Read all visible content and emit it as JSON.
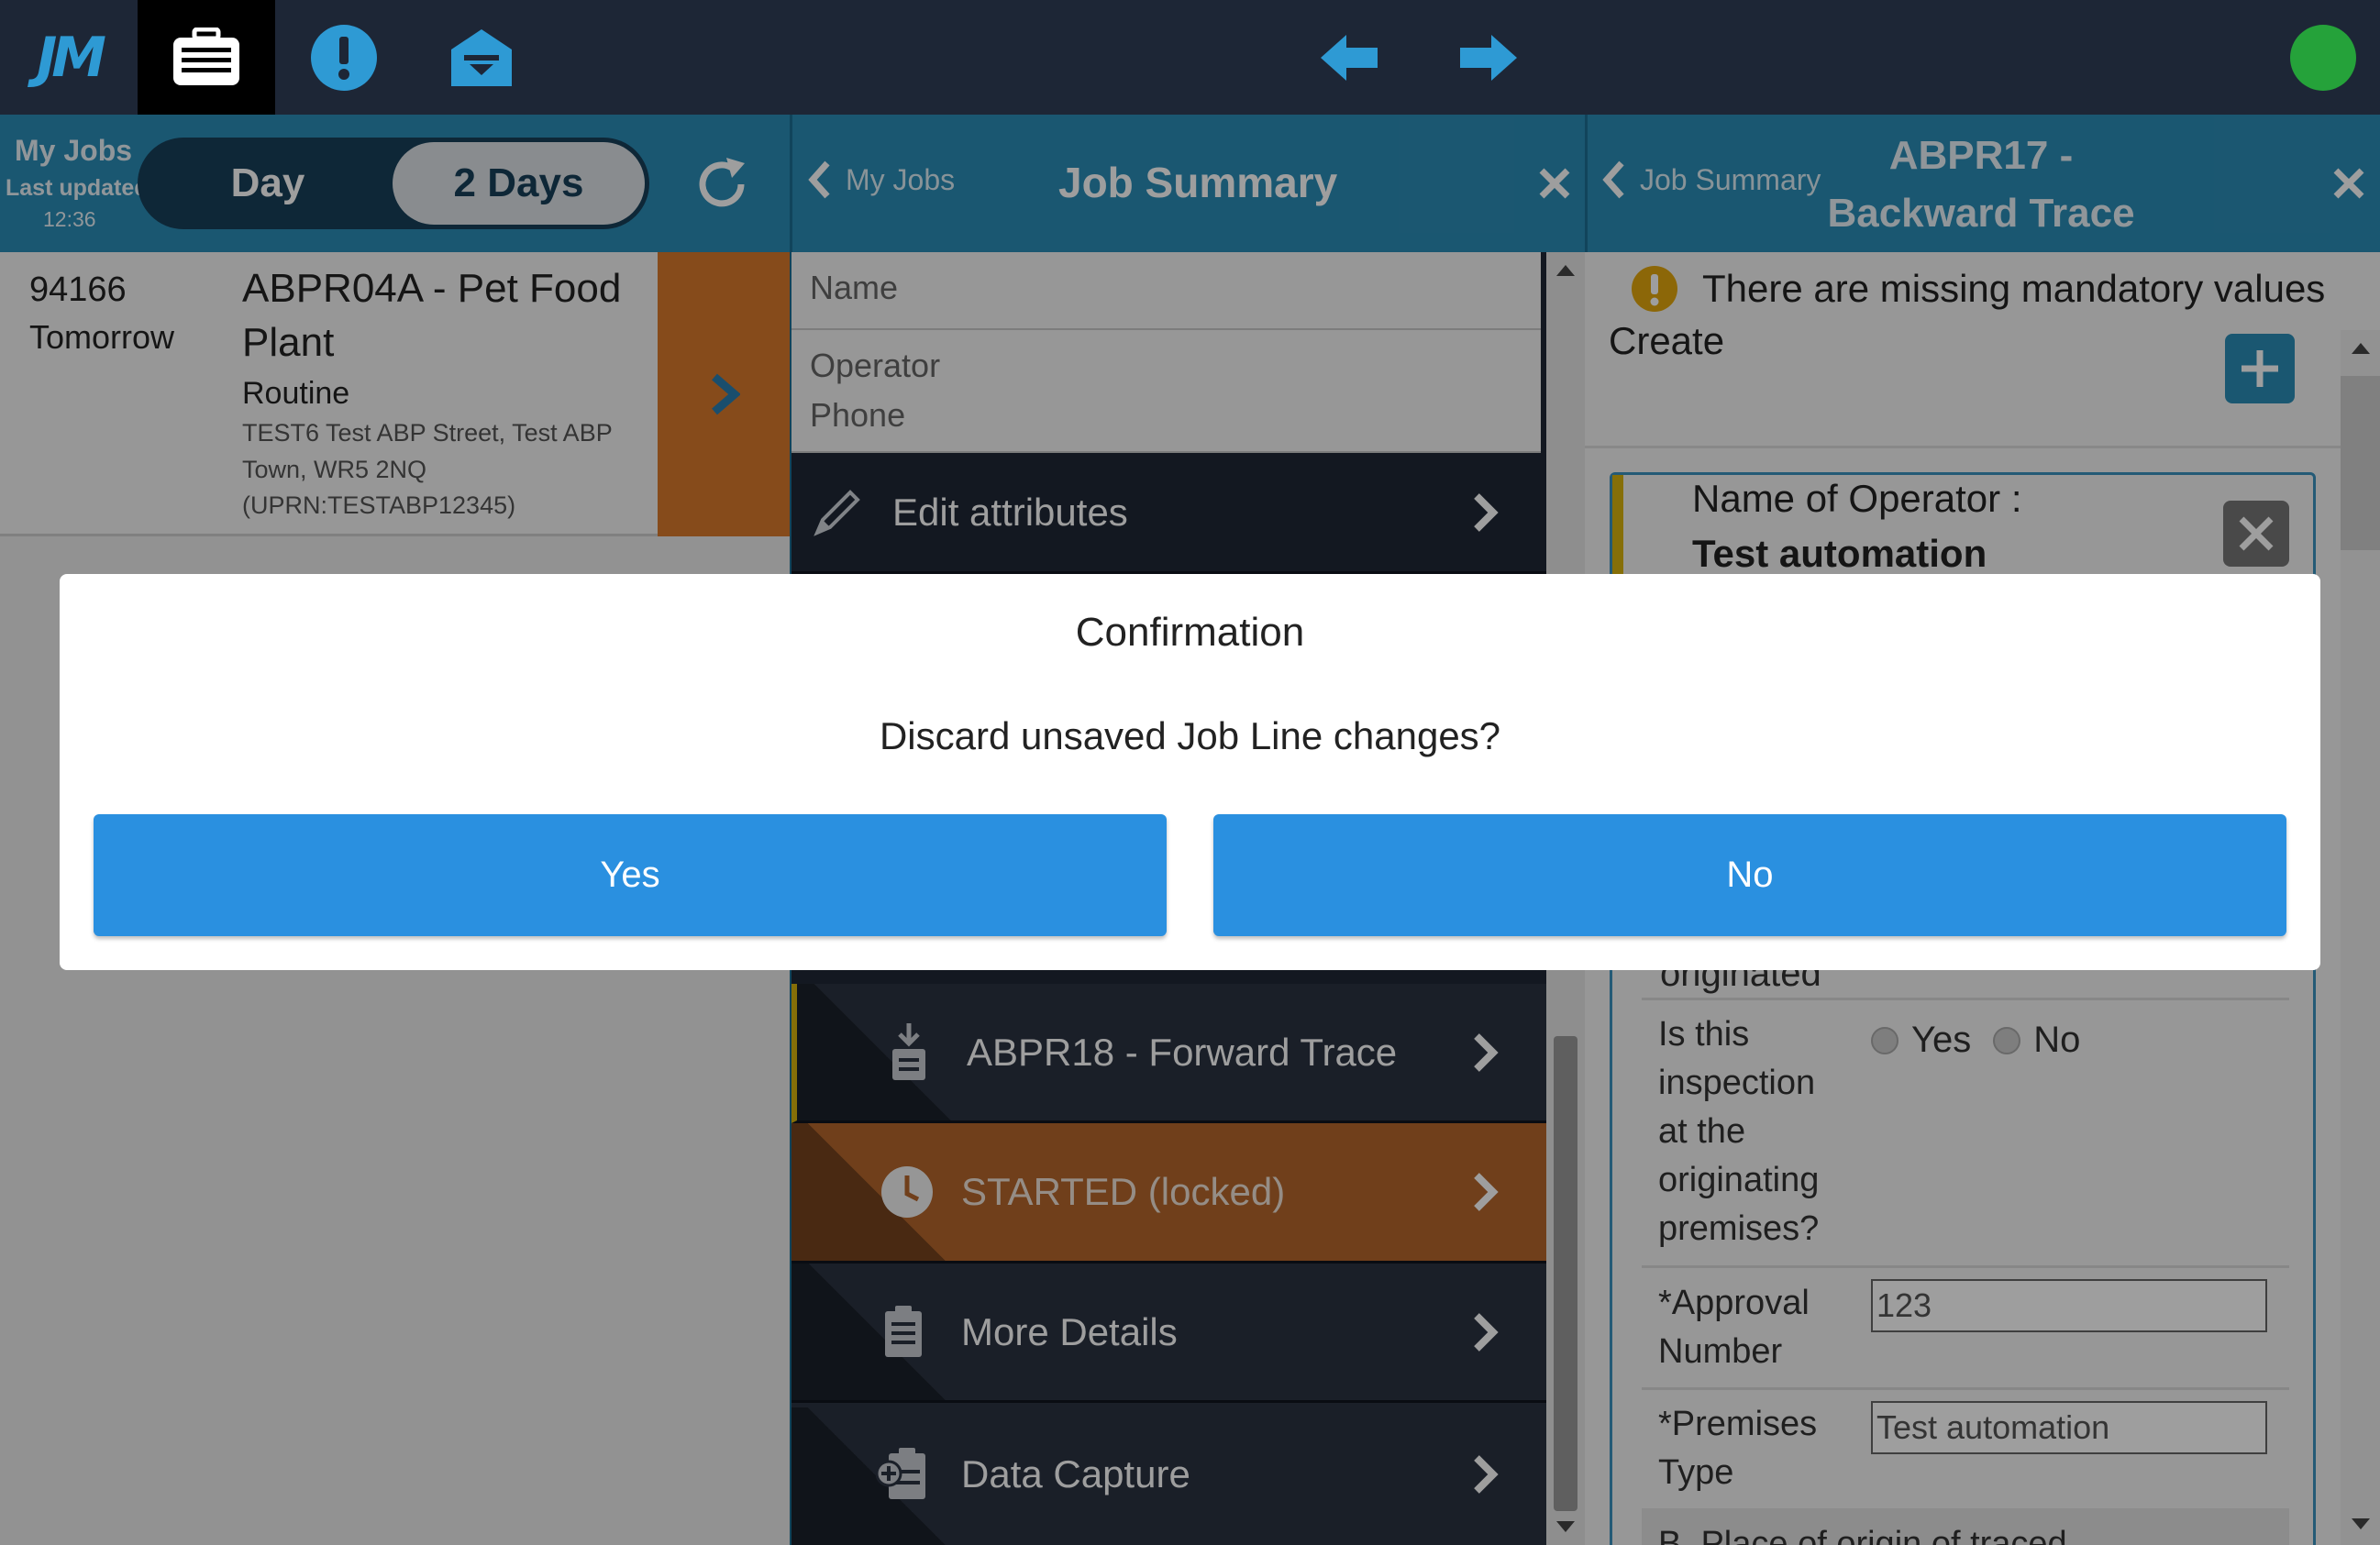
{
  "top_bar": {
    "logo": "JM",
    "icons": [
      "jobs-briefcase-icon",
      "alert-icon",
      "inbox-icon",
      "back-arrow-icon",
      "forward-arrow-icon",
      "status-online-icon"
    ],
    "status_color": "#25a23a"
  },
  "left_panel": {
    "header": {
      "title": "My Jobs",
      "last_updated_label": "Last updated",
      "last_updated_time": "12:36",
      "toggle_day": "Day",
      "toggle_2days": "2 Days",
      "selected": "2 Days"
    },
    "job": {
      "id": "94166",
      "when": "Tomorrow",
      "title_line1": "ABPR04A - Pet Food",
      "title_line2": "Plant",
      "type": "Routine",
      "address_line1": "TEST6 Test ABP Street, Test ABP",
      "address_line2": "Town, WR5 2NQ",
      "address_line3": "(UPRN:TESTABP12345)"
    }
  },
  "mid_panel": {
    "header": {
      "back_label": "My Jobs",
      "title": "Job Summary"
    },
    "fields": [
      "Name",
      "Operator",
      "Phone"
    ],
    "edit_attributes": "Edit attributes",
    "items": [
      {
        "label": "ABPR18 - Forward Trace",
        "icon": "download-clipboard-icon"
      },
      {
        "label": "STARTED (locked)",
        "icon": "clock-icon"
      },
      {
        "label": "More Details",
        "icon": "clipboard-icon"
      },
      {
        "label": "Data Capture",
        "icon": "add-clipboard-icon"
      }
    ],
    "status_color": "#d9792c"
  },
  "right_panel": {
    "header": {
      "back_label": "Job Summary",
      "title_line1": "ABPR17 -",
      "title_line2": "Backward Trace"
    },
    "warning": "There are missing mandatory values",
    "create_label": "Create",
    "card": {
      "label": "Name of Operator :",
      "value": "Test automation"
    },
    "clipped_label": "originated",
    "inspection_question": [
      "Is this",
      "inspection",
      "at the",
      "originating",
      "premises?"
    ],
    "radio_yes": "Yes",
    "radio_no": "No",
    "approval_label": [
      "*Approval",
      "Number"
    ],
    "approval_value": "123",
    "premises_label": [
      "*Premises",
      "Type"
    ],
    "premises_value": "Test automation",
    "partial_label": "B. Place of origin of traced"
  },
  "dialog": {
    "title": "Confirmation",
    "message": "Discard unsaved Job Line changes?",
    "yes": "Yes",
    "no": "No",
    "button_color": "#2a90e0"
  }
}
